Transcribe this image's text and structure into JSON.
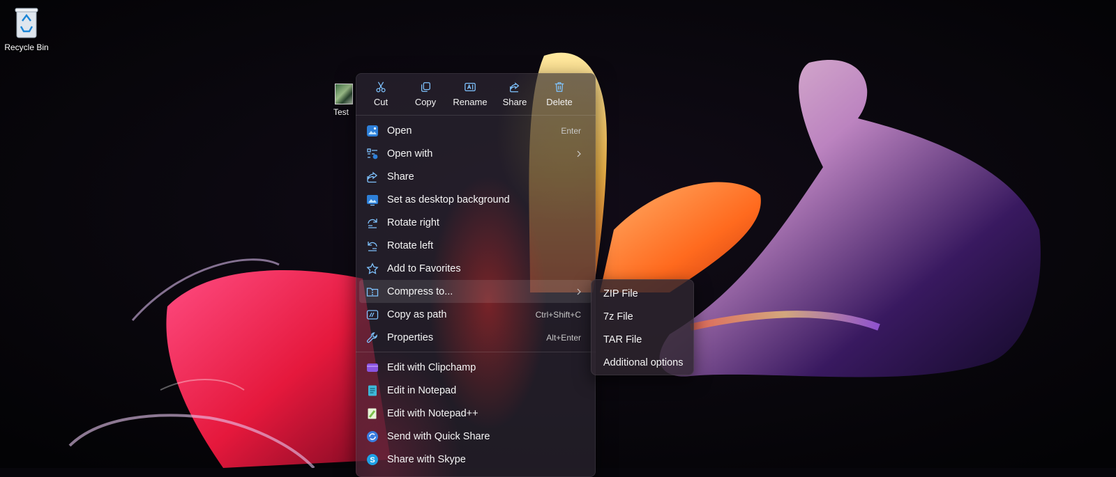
{
  "desktop": {
    "icons": [
      {
        "label": "Recycle Bin"
      },
      {
        "label": "Test"
      }
    ]
  },
  "context_menu": {
    "toolbar": [
      {
        "label": "Cut",
        "icon": "scissors-icon"
      },
      {
        "label": "Copy",
        "icon": "copy-icon"
      },
      {
        "label": "Rename",
        "icon": "rename-icon"
      },
      {
        "label": "Share",
        "icon": "share-icon"
      },
      {
        "label": "Delete",
        "icon": "trash-icon"
      }
    ],
    "items": [
      {
        "label": "Open",
        "shortcut": "Enter",
        "icon": "photos-app-icon"
      },
      {
        "label": "Open with",
        "icon": "open-with-icon",
        "submenu": true
      },
      {
        "label": "Share",
        "icon": "share-icon"
      },
      {
        "label": "Set as desktop background",
        "icon": "wallpaper-icon"
      },
      {
        "label": "Rotate right",
        "icon": "rotate-right-icon"
      },
      {
        "label": "Rotate left",
        "icon": "rotate-left-icon"
      },
      {
        "label": "Add to Favorites",
        "icon": "star-icon"
      },
      {
        "label": "Compress to...",
        "icon": "zip-folder-icon",
        "submenu": true
      },
      {
        "label": "Copy as path",
        "shortcut": "Ctrl+Shift+C",
        "icon": "copy-path-icon"
      },
      {
        "label": "Properties",
        "shortcut": "Alt+Enter",
        "icon": "wrench-icon"
      }
    ],
    "apps": [
      {
        "label": "Edit with Clipchamp",
        "icon": "clipchamp-icon",
        "color": "#8a55e0"
      },
      {
        "label": "Edit in Notepad",
        "icon": "notepad-icon",
        "color": "#3fb8d8"
      },
      {
        "label": "Edit with Notepad++",
        "icon": "notepadpp-icon",
        "color": "#7cc04a"
      },
      {
        "label": "Send with Quick Share",
        "icon": "quick-share-icon",
        "color": "#3b7ee0"
      },
      {
        "label": "Share with Skype",
        "icon": "skype-icon",
        "color": "#1ea1e6"
      }
    ]
  },
  "compress_submenu": {
    "items": [
      {
        "label": "ZIP File"
      },
      {
        "label": "7z File"
      },
      {
        "label": "TAR File"
      },
      {
        "label": "Additional options"
      }
    ]
  },
  "colors": {
    "accent_icon": "#7fc3ff",
    "menu_text": "#f5f5f5"
  }
}
